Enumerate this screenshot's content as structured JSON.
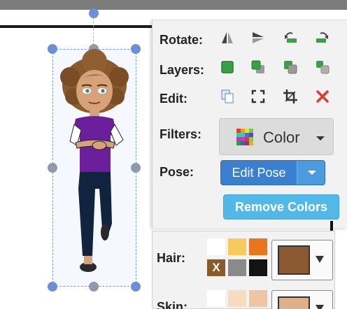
{
  "toolbar": {
    "rotate_label": "Rotate:",
    "layers_label": "Layers:",
    "edit_label": "Edit:",
    "filters_label": "Filters:",
    "pose_label": "Pose:",
    "filters_button": "Color",
    "edit_pose_button": "Edit Pose",
    "remove_colors_button": "Remove Colors",
    "icons": {
      "rotate": [
        "flip-horizontal-icon",
        "flip-vertical-icon",
        "rotate-left-icon",
        "rotate-right-icon"
      ],
      "layers": [
        "bring-to-front-icon",
        "bring-forward-icon",
        "send-backward-icon",
        "send-to-back-icon"
      ],
      "edit": [
        "copy-icon",
        "fullscreen-icon",
        "crop-icon",
        "delete-icon"
      ]
    }
  },
  "colors": {
    "hair_label": "Hair:",
    "skin_label": "Skin:",
    "hair_swatches": [
      "#ffffff",
      "#f7ca5e",
      "#e8761c",
      "#8a5a2b",
      "#8a8a8a",
      "#141414"
    ],
    "hair_swatch_x": "X",
    "hair_selected": "#8b5a33",
    "skin_swatches": [
      "#ffffff",
      "#f6dcc0",
      "#eec6a3"
    ],
    "skin_selected": "#ddb08a"
  }
}
